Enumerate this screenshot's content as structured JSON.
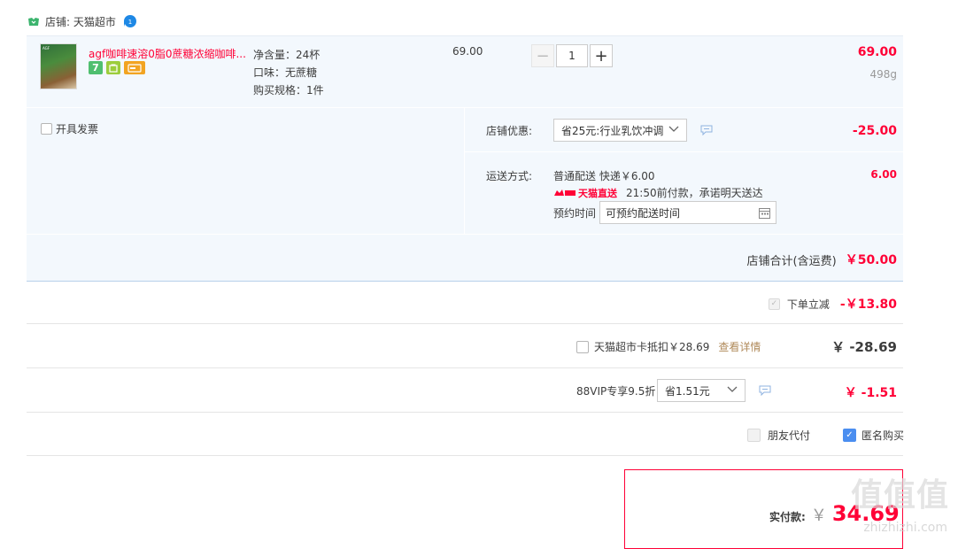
{
  "shop": {
    "label": "店铺: 天猫超市",
    "wangwang_count": "1"
  },
  "item": {
    "title": "agf咖啡速溶0脂0蔗糖浓缩咖啡...",
    "thumb_text": "AGF",
    "badges": {
      "seven": "7"
    },
    "specs": [
      "净含量：24杯",
      "口味：无蔗糖",
      "购买规格：1件"
    ],
    "unit_price": "69.00",
    "quantity": "1",
    "minus": "−",
    "plus": "+",
    "total": "69.00",
    "weight": "498g"
  },
  "invoice": {
    "label": "开具发票"
  },
  "shop_discount": {
    "label": "店铺优惠:",
    "selected": "省25元:行业乳饮冲调",
    "amount": "-25.00"
  },
  "shipping": {
    "label": "运送方式:",
    "method": "普通配送 快递￥6.00",
    "tag": "天猫直送",
    "promise": "21:50前付款，承诺明天送达",
    "schedule_label": "预约时间",
    "schedule_value": "可预约配送时间",
    "amount": "6.00"
  },
  "shop_total": {
    "label": "店铺合计(含运费)",
    "value": "￥50.00"
  },
  "order_discount": {
    "label": "下单立减",
    "value": "-￥13.80"
  },
  "tmall_card": {
    "label": "天猫超市卡抵扣￥28.69",
    "link": "查看详情",
    "value": "￥ -28.69"
  },
  "vip": {
    "label": "88VIP专享9.5折",
    "selected": "省1.51元",
    "value": "￥ -1.51"
  },
  "options": {
    "friend_pay": "朋友代付",
    "anonymous": "匿名购买"
  },
  "payment": {
    "label": "实付款:",
    "currency": "￥",
    "value": "34.69"
  },
  "watermark": {
    "main": "值值值",
    "sub": "zhizhizhi.com"
  },
  "colors": {
    "accent": "#ff0036",
    "panel": "#f3f8fd",
    "link": "#b08a5a",
    "check": "#4b8ef0"
  }
}
